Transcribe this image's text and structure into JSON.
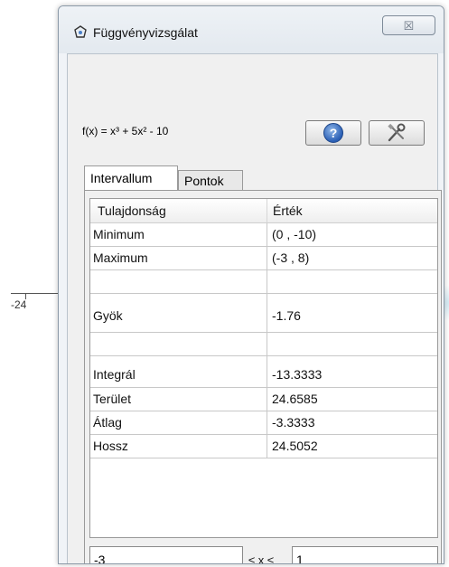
{
  "background": {
    "axis_label": "-24"
  },
  "window": {
    "title": "Függvényvizsgálat",
    "close_label": "☒"
  },
  "function_expression": "f(x) = x³ + 5x² - 10",
  "tabs": [
    {
      "label": "Intervallum",
      "active": true
    },
    {
      "label": "Pontok",
      "active": false
    }
  ],
  "table": {
    "headers": [
      "Tulajdonság",
      "Érték"
    ],
    "rows": [
      {
        "property": "Minimum",
        "value": "(0 , -10)"
      },
      {
        "property": "Maximum",
        "value": "(-3 , 8)"
      },
      {
        "property": "",
        "value": ""
      },
      {
        "property": "Gyök",
        "value": "-1.76"
      },
      {
        "property": "",
        "value": ""
      },
      {
        "property": "Integrál",
        "value": "-13.3333"
      },
      {
        "property": "Terület",
        "value": "24.6585"
      },
      {
        "property": "Átlag",
        "value": "-3.3333"
      },
      {
        "property": "Hossz",
        "value": "24.5052"
      }
    ]
  },
  "interval": {
    "from": "-3",
    "relation": "≤ x ≤",
    "to": "1"
  },
  "icons": {
    "app": "function-inspector-icon",
    "help": "help-icon",
    "settings": "tools-icon"
  },
  "colors": {
    "help_accent": "#2a5fb5",
    "table_border": "#9a9a9a"
  }
}
